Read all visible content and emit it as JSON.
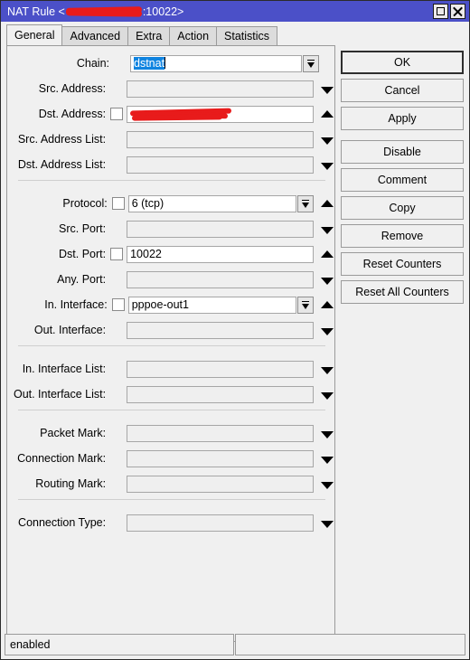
{
  "window": {
    "title_prefix": "NAT Rule <",
    "title_redacted": "",
    "title_suffix": ":10022>",
    "maximize_icon": "maximize-icon",
    "close_icon": "close-icon"
  },
  "tabs": [
    {
      "label": "General",
      "active": true
    },
    {
      "label": "Advanced",
      "active": false
    },
    {
      "label": "Extra",
      "active": false
    },
    {
      "label": "Action",
      "active": false
    },
    {
      "label": "Statistics",
      "active": false
    }
  ],
  "fields": [
    {
      "label": "Chain:",
      "value": "dstnat",
      "placeholder": "",
      "checkbox": false,
      "editable": true,
      "selected": true,
      "control": "combo",
      "redacted": false
    },
    {
      "label": "Src. Address:",
      "value": "",
      "placeholder": "",
      "checkbox": false,
      "editable": false,
      "selected": false,
      "control": "arrow-down",
      "redacted": false
    },
    {
      "label": "Dst. Address:",
      "value": "",
      "placeholder": "",
      "checkbox": true,
      "editable": true,
      "selected": false,
      "control": "arrow-up",
      "redacted": true
    },
    {
      "label": "Src. Address List:",
      "value": "",
      "placeholder": "",
      "checkbox": false,
      "editable": false,
      "selected": false,
      "control": "arrow-down",
      "redacted": false
    },
    {
      "label": "Dst. Address List:",
      "value": "",
      "placeholder": "",
      "checkbox": false,
      "editable": false,
      "selected": false,
      "control": "arrow-down",
      "redacted": false
    },
    {
      "label": "Protocol:",
      "value": "6 (tcp)",
      "placeholder": "",
      "checkbox": true,
      "editable": true,
      "selected": false,
      "control": "combo-up",
      "redacted": false
    },
    {
      "label": "Src. Port:",
      "value": "",
      "placeholder": "",
      "checkbox": false,
      "editable": false,
      "selected": false,
      "control": "arrow-down",
      "redacted": false
    },
    {
      "label": "Dst. Port:",
      "value": "10022",
      "placeholder": "",
      "checkbox": true,
      "editable": true,
      "selected": false,
      "control": "arrow-up",
      "redacted": false
    },
    {
      "label": "Any. Port:",
      "value": "",
      "placeholder": "",
      "checkbox": false,
      "editable": false,
      "selected": false,
      "control": "arrow-down",
      "redacted": false
    },
    {
      "label": "In. Interface:",
      "value": "pppoe-out1",
      "placeholder": "",
      "checkbox": true,
      "editable": true,
      "selected": false,
      "control": "combo-up",
      "redacted": false
    },
    {
      "label": "Out. Interface:",
      "value": "",
      "placeholder": "",
      "checkbox": false,
      "editable": false,
      "selected": false,
      "control": "arrow-down",
      "redacted": false
    },
    {
      "label": "In. Interface List:",
      "value": "",
      "placeholder": "",
      "checkbox": false,
      "editable": false,
      "selected": false,
      "control": "arrow-down",
      "redacted": false
    },
    {
      "label": "Out. Interface List:",
      "value": "",
      "placeholder": "",
      "checkbox": false,
      "editable": false,
      "selected": false,
      "control": "arrow-down",
      "redacted": false
    },
    {
      "label": "Packet Mark:",
      "value": "",
      "placeholder": "",
      "checkbox": false,
      "editable": false,
      "selected": false,
      "control": "arrow-down",
      "redacted": false
    },
    {
      "label": "Connection Mark:",
      "value": "",
      "placeholder": "",
      "checkbox": false,
      "editable": false,
      "selected": false,
      "control": "arrow-down",
      "redacted": false
    },
    {
      "label": "Routing Mark:",
      "value": "",
      "placeholder": "",
      "checkbox": false,
      "editable": false,
      "selected": false,
      "control": "arrow-down",
      "redacted": false
    },
    {
      "label": "Connection Type:",
      "value": "",
      "placeholder": "",
      "checkbox": false,
      "editable": false,
      "selected": false,
      "control": "arrow-down",
      "redacted": false
    }
  ],
  "buttons": [
    {
      "label": "OK",
      "default": true,
      "gap": false
    },
    {
      "label": "Cancel",
      "default": false,
      "gap": false
    },
    {
      "label": "Apply",
      "default": false,
      "gap": false
    },
    {
      "label": "Disable",
      "default": false,
      "gap": true
    },
    {
      "label": "Comment",
      "default": false,
      "gap": false
    },
    {
      "label": "Copy",
      "default": false,
      "gap": false
    },
    {
      "label": "Remove",
      "default": false,
      "gap": false
    },
    {
      "label": "Reset Counters",
      "default": false,
      "gap": false
    },
    {
      "label": "Reset All Counters",
      "default": false,
      "gap": false
    }
  ],
  "statusbar": {
    "state": "enabled",
    "secondary": ""
  },
  "colors": {
    "titlebar": "#4b50c8",
    "selection": "#1084e0",
    "redaction": "#e81b1b",
    "panel": "#f0f0f0",
    "border": "#9a9a9a"
  }
}
